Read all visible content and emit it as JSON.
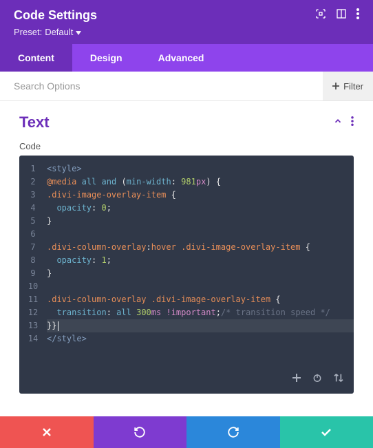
{
  "header": {
    "title": "Code Settings",
    "preset_label": "Preset:",
    "preset_value": "Default"
  },
  "tabs": [
    {
      "label": "Content",
      "active": true
    },
    {
      "label": "Design",
      "active": false
    },
    {
      "label": "Advanced",
      "active": false
    }
  ],
  "search": {
    "placeholder": "Search Options",
    "filter_label": "Filter"
  },
  "section": {
    "title": "Text",
    "field_label": "Code"
  },
  "code": {
    "lines": [
      {
        "n": "1",
        "tokens": [
          {
            "c": "t-tag",
            "t": "<style>"
          }
        ]
      },
      {
        "n": "2",
        "tokens": [
          {
            "c": "t-atrule",
            "t": "@media"
          },
          {
            "c": "",
            "t": " "
          },
          {
            "c": "t-kw",
            "t": "all"
          },
          {
            "c": "",
            "t": " "
          },
          {
            "c": "t-kw",
            "t": "and"
          },
          {
            "c": "",
            "t": " "
          },
          {
            "c": "t-punc",
            "t": "("
          },
          {
            "c": "t-prop",
            "t": "min-width"
          },
          {
            "c": "t-punc",
            "t": ":"
          },
          {
            "c": "",
            "t": " "
          },
          {
            "c": "t-num",
            "t": "981"
          },
          {
            "c": "t-unit",
            "t": "px"
          },
          {
            "c": "t-punc",
            "t": ")"
          },
          {
            "c": "",
            "t": " "
          },
          {
            "c": "t-punc",
            "t": "{"
          }
        ]
      },
      {
        "n": "3",
        "tokens": [
          {
            "c": "t-class",
            "t": ".divi-image-overlay-item"
          },
          {
            "c": "",
            "t": " "
          },
          {
            "c": "t-punc",
            "t": "{"
          }
        ]
      },
      {
        "n": "4",
        "tokens": [
          {
            "c": "",
            "t": "  "
          },
          {
            "c": "t-prop",
            "t": "opacity"
          },
          {
            "c": "t-punc",
            "t": ":"
          },
          {
            "c": "",
            "t": " "
          },
          {
            "c": "t-num",
            "t": "0"
          },
          {
            "c": "t-punc",
            "t": ";"
          }
        ]
      },
      {
        "n": "5",
        "tokens": [
          {
            "c": "t-punc",
            "t": "}"
          }
        ]
      },
      {
        "n": "6",
        "tokens": []
      },
      {
        "n": "7",
        "tokens": [
          {
            "c": "t-class",
            "t": ".divi-column-overlay"
          },
          {
            "c": "t-punc",
            "t": ":"
          },
          {
            "c": "t-pseudo",
            "t": "hover"
          },
          {
            "c": "",
            "t": " "
          },
          {
            "c": "t-class",
            "t": ".divi-image-overlay-item"
          },
          {
            "c": "",
            "t": " "
          },
          {
            "c": "t-punc",
            "t": "{"
          }
        ]
      },
      {
        "n": "8",
        "tokens": [
          {
            "c": "",
            "t": "  "
          },
          {
            "c": "t-prop",
            "t": "opacity"
          },
          {
            "c": "t-punc",
            "t": ":"
          },
          {
            "c": "",
            "t": " "
          },
          {
            "c": "t-num",
            "t": "1"
          },
          {
            "c": "t-punc",
            "t": ";"
          }
        ]
      },
      {
        "n": "9",
        "tokens": [
          {
            "c": "t-punc",
            "t": "}"
          }
        ]
      },
      {
        "n": "10",
        "tokens": []
      },
      {
        "n": "11",
        "tokens": [
          {
            "c": "t-class",
            "t": ".divi-column-overlay"
          },
          {
            "c": "",
            "t": " "
          },
          {
            "c": "t-class",
            "t": ".divi-image-overlay-item"
          },
          {
            "c": "",
            "t": " "
          },
          {
            "c": "t-punc",
            "t": "{"
          }
        ]
      },
      {
        "n": "12",
        "tokens": [
          {
            "c": "",
            "t": "  "
          },
          {
            "c": "t-prop",
            "t": "transition"
          },
          {
            "c": "t-punc",
            "t": ":"
          },
          {
            "c": "",
            "t": " "
          },
          {
            "c": "t-kw",
            "t": "all"
          },
          {
            "c": "",
            "t": " "
          },
          {
            "c": "t-num",
            "t": "300"
          },
          {
            "c": "t-unit",
            "t": "ms"
          },
          {
            "c": "",
            "t": " "
          },
          {
            "c": "t-mod",
            "t": "!important"
          },
          {
            "c": "t-punc",
            "t": ";"
          },
          {
            "c": "t-cmt",
            "t": "/* transition speed */"
          }
        ]
      },
      {
        "n": "13",
        "tokens": [
          {
            "c": "t-punc",
            "t": "}}"
          }
        ],
        "cursor": true
      },
      {
        "n": "14",
        "tokens": [
          {
            "c": "t-tag",
            "t": "</style>"
          }
        ]
      }
    ]
  }
}
